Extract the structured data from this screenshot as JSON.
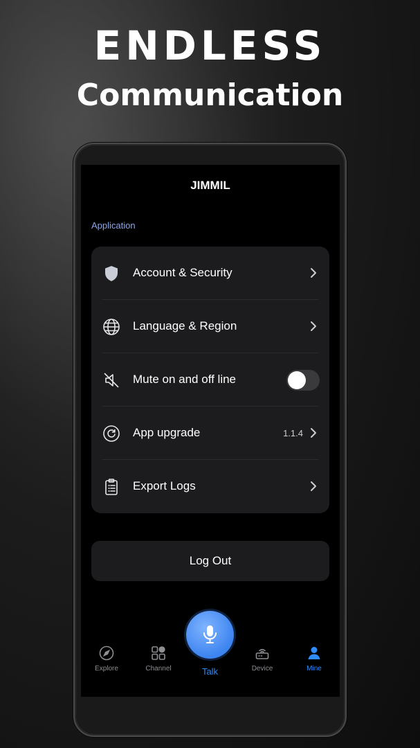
{
  "promo": {
    "headline_line1": "ENDLESS",
    "headline_line2": "Communication"
  },
  "app": {
    "title": "JIMMIL"
  },
  "settings": {
    "section_label": "Application",
    "items": [
      {
        "label": "Account & Security",
        "icon": "shield-icon"
      },
      {
        "label": "Language & Region",
        "icon": "globe-icon"
      },
      {
        "label": "Mute on and off line",
        "icon": "mute-icon",
        "toggle_on": false
      },
      {
        "label": "App upgrade",
        "icon": "upgrade-icon",
        "value": "1.1.4"
      },
      {
        "label": "Export Logs",
        "icon": "clipboard-icon"
      }
    ],
    "logout_label": "Log Out"
  },
  "tabbar": {
    "tabs": [
      {
        "label": "Explore",
        "icon": "compass-icon"
      },
      {
        "label": "Channel",
        "icon": "grid-icon"
      },
      {
        "label": "Talk",
        "icon": "mic-icon"
      },
      {
        "label": "Device",
        "icon": "router-icon"
      },
      {
        "label": "Mine",
        "icon": "person-icon"
      }
    ],
    "active_tab": "Mine"
  },
  "colors": {
    "accent": "#2f8cff",
    "section_label": "#8ea6e8",
    "card_bg": "#1c1c1e"
  }
}
